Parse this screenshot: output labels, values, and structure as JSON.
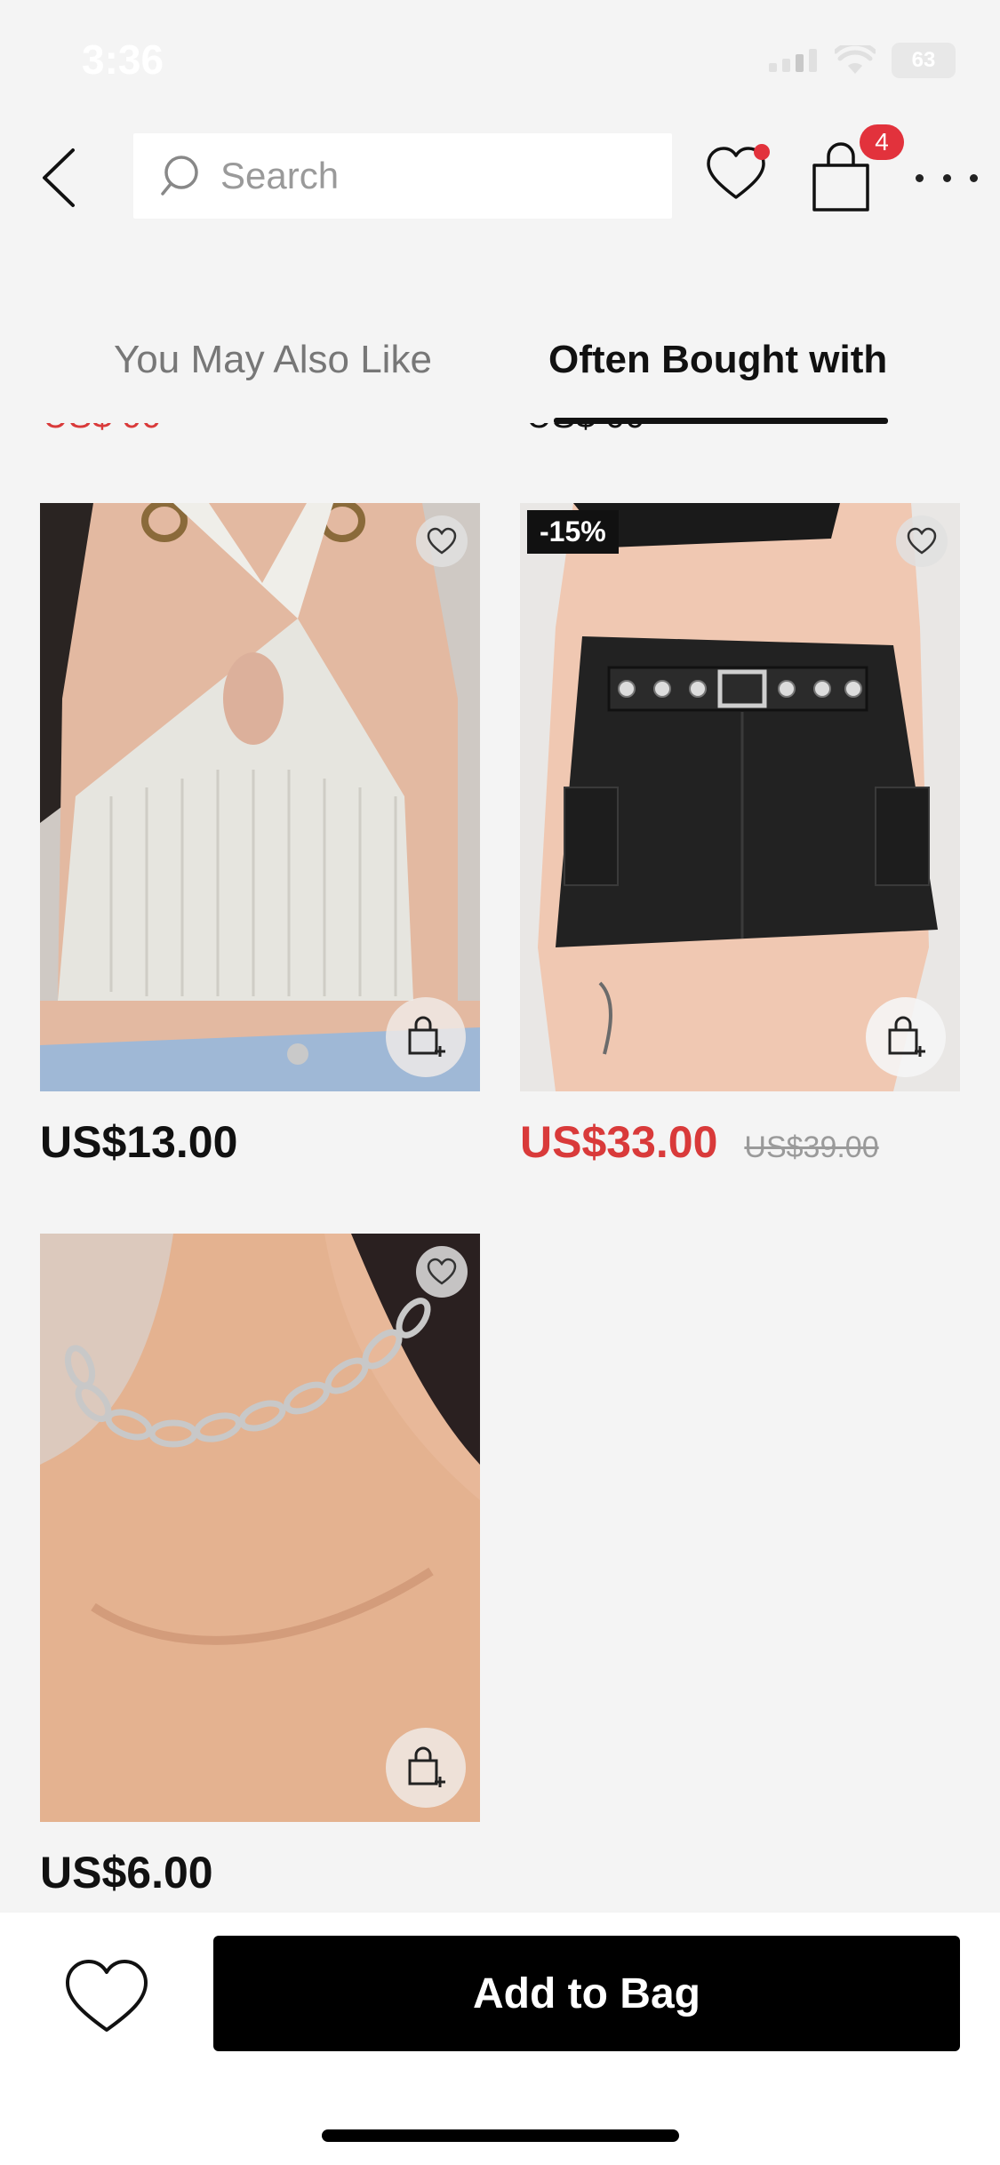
{
  "status_bar": {
    "time": "3:36",
    "battery": "63"
  },
  "header": {
    "search_placeholder": "Search",
    "bag_count": "4",
    "icons": [
      "back-arrow-icon",
      "search-icon",
      "heart-icon",
      "shopping-bag-icon",
      "more-dots-icon"
    ]
  },
  "tabs": [
    {
      "label": "You May Also Like",
      "active": false
    },
    {
      "label": "Often Bought with",
      "active": true
    }
  ],
  "products": [
    {
      "name": "white halter knit crop top",
      "price": "US$13.00",
      "old_price": null,
      "discount": null
    },
    {
      "name": "black belted cargo mini skirt",
      "price": "US$33.00",
      "old_price": "US$39.00",
      "discount": "-15%"
    },
    {
      "name": "silver chain necklace",
      "price": "US$6.00",
      "old_price": null,
      "discount": null
    }
  ],
  "bottom_bar": {
    "add_to_bag": "Add to Bag"
  },
  "colors": {
    "accent_red": "#d93a3a",
    "badge_red": "#e2323c",
    "background": "#f4f4f4",
    "button_black": "#000000"
  }
}
